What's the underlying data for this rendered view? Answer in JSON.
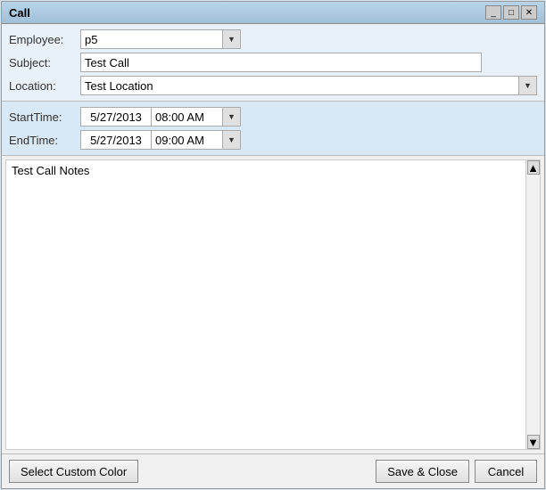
{
  "window": {
    "title": "Call",
    "title_suffix": ""
  },
  "form": {
    "employee_label": "Employee:",
    "employee_value": "p5",
    "subject_label": "Subject:",
    "subject_value": "Test Call",
    "location_label": "Location:",
    "location_value": "Test Location"
  },
  "datetime": {
    "start_label": "StartTime:",
    "start_date": "5/27/2013",
    "start_time": "08:00 AM",
    "end_label": "EndTime:",
    "end_date": "5/27/2013",
    "end_time": "09:00 AM"
  },
  "notes": {
    "value": "Test Call Notes"
  },
  "footer": {
    "custom_color_label": "Select Custom Color",
    "save_label": "Save & Close",
    "cancel_label": "Cancel"
  },
  "icons": {
    "dropdown_arrow": "▼",
    "scroll_up": "▲",
    "scroll_down": "▼"
  }
}
